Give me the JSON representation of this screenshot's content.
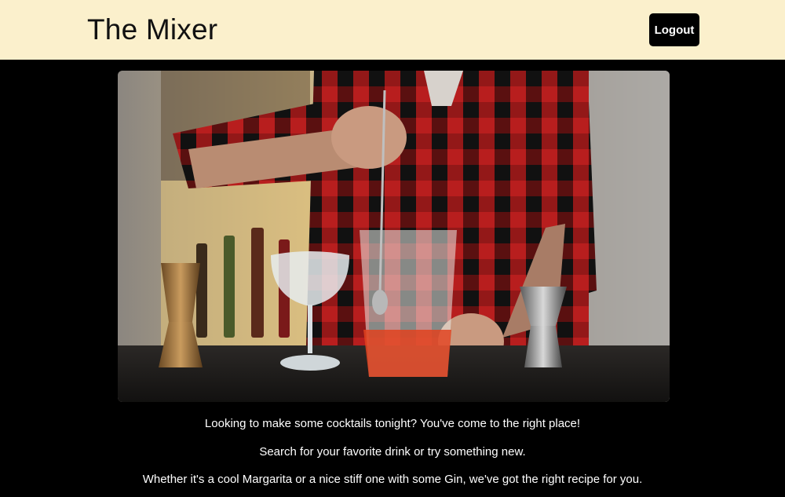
{
  "header": {
    "brand": "The Mixer",
    "logout_label": "Logout"
  },
  "hero": {
    "image_icon": "bartender-stirring-cocktail-photo"
  },
  "intro": {
    "line1": "Looking to make some cocktails tonight? You've come to the right place!",
    "line2": "Search for your favorite drink or try something new.",
    "line3": "Whether it's a cool Margarita or a nice stiff one with some Gin, we've got the right recipe for you."
  },
  "colors": {
    "header_bg": "#fbf0cc",
    "page_bg": "#000000",
    "button_bg": "#000000",
    "text_light": "#ffffff"
  }
}
